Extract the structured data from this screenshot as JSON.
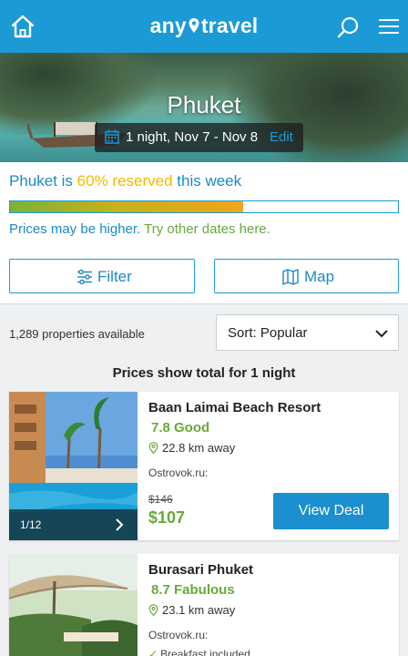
{
  "header": {
    "logo_left": "any",
    "logo_right": "travel",
    "icons": [
      "home-icon",
      "location-pin-icon",
      "search-icon",
      "hamburger-menu-icon"
    ]
  },
  "hero": {
    "city": "Phuket",
    "dates": "1 night, Nov 7 - Nov 8",
    "edit_label": "Edit"
  },
  "availability": {
    "prefix": "Phuket is ",
    "percent_text": "60% reserved",
    "suffix": " this week",
    "reserved_fraction": 0.6,
    "hint_text": "Prices may be higher. ",
    "hint_link": "Try other dates here."
  },
  "controls": {
    "filter_label": "Filter",
    "map_label": "Map",
    "count_text": "1,289 properties available",
    "sort_label": "Sort: Popular",
    "price_note": "Prices show total for 1 night"
  },
  "colors": {
    "brand": "#1b9ad6",
    "rating": "#6aa83a",
    "highlight": "#f5b800"
  },
  "listings": [
    {
      "name": "Baan Laimai Beach Resort",
      "rating": "7.8 Good",
      "distance": "22.8 km away",
      "provider": "Ostrovok.ru:",
      "old_price": "$146",
      "price": "$107",
      "deal_label": "View Deal",
      "photo_counter": "1/12"
    },
    {
      "name": "Burasari Phuket",
      "rating": "8.7 Fabulous",
      "distance": "23.1 km away",
      "provider": "Ostrovok.ru:",
      "extra": "Breakfast included"
    }
  ]
}
